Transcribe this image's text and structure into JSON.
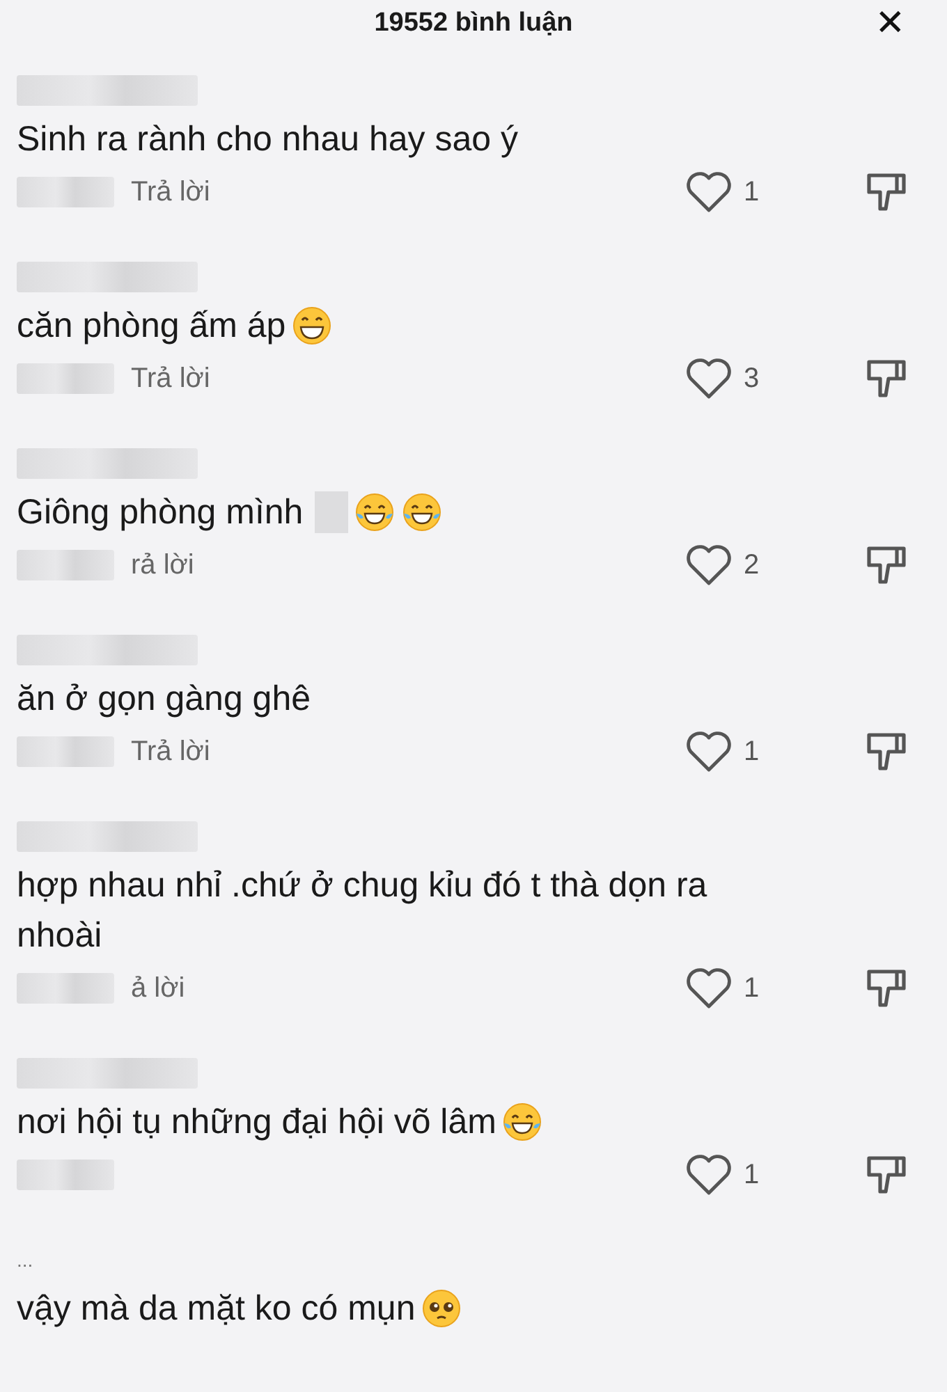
{
  "header": {
    "title": "19552 bình luận",
    "close": "✕"
  },
  "comments": [
    {
      "text": "Sinh ra rành cho nhau hay sao ý",
      "reply": "Trả lời",
      "likes": "1"
    },
    {
      "text": "căn phòng ấm áp",
      "emojis": [
        {
          "kind": "grin"
        }
      ],
      "reply": "Trả lời",
      "likes": "3"
    },
    {
      "text": "Giông phòng mình",
      "emojis": [
        {
          "kind": "blur"
        },
        {
          "kind": "tears"
        },
        {
          "kind": "tears"
        }
      ],
      "reply": "rả lời",
      "likes": "2"
    },
    {
      "text": "ăn ở gọn gàng ghê",
      "reply": "Trả lời",
      "likes": "1"
    },
    {
      "text": "hợp nhau nhỉ .chứ ở chug kỉu đó t thà dọn ra nhoài",
      "reply": "ả lời",
      "likes": "1"
    },
    {
      "text": "nơi hội tụ những đại hội võ lâm",
      "emojis": [
        {
          "kind": "tears"
        }
      ],
      "likes": "1"
    },
    {
      "user": "...",
      "text": "vậy mà da mặt ko có mụn",
      "emojis": [
        {
          "kind": "pleading"
        }
      ]
    }
  ]
}
